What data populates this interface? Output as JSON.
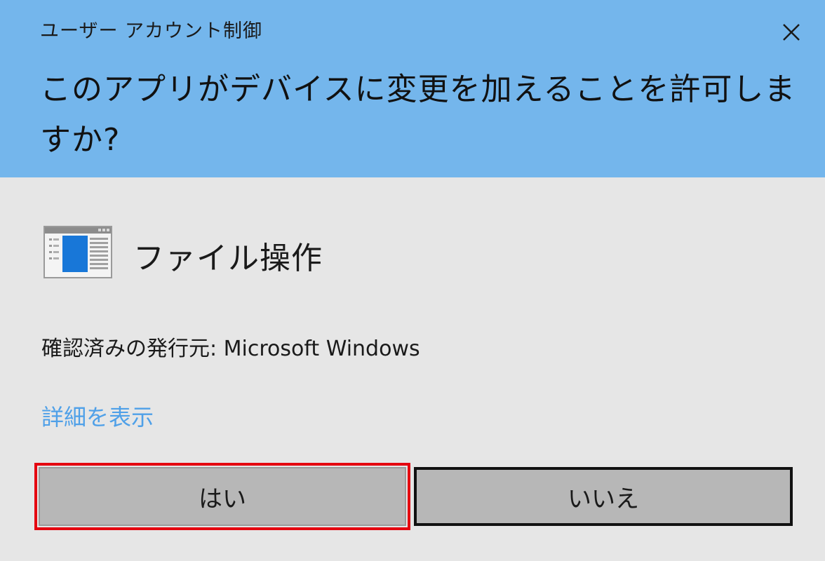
{
  "window": {
    "title": "ユーザー アカウント制御",
    "header_color": "#74b6ec"
  },
  "close_icon": "close-icon",
  "question": "このアプリがデバイスに変更を加えることを許可しますか?",
  "app": {
    "icon": "application-window-icon",
    "name": "ファイル操作"
  },
  "publisher": {
    "text": "確認済みの発行元: Microsoft Windows"
  },
  "details_link": {
    "label": "詳細を表示",
    "color": "#4fa0e8"
  },
  "buttons": {
    "yes_label": "はい",
    "no_label": "いいえ",
    "highlight_color": "#e4000f"
  }
}
